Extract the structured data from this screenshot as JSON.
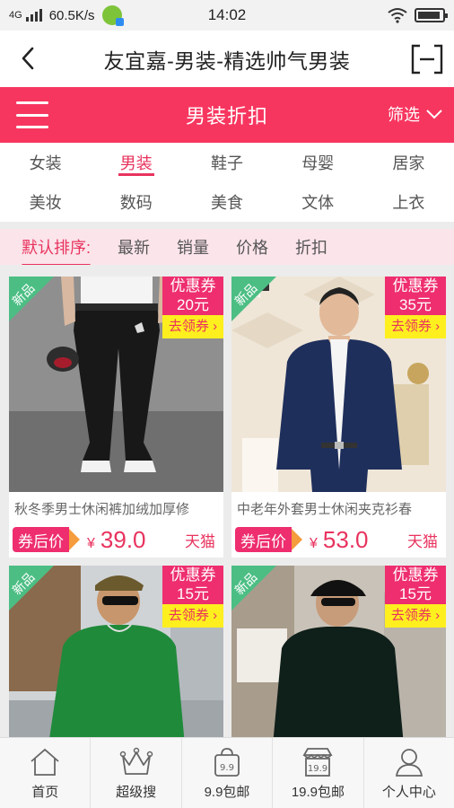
{
  "status_bar": {
    "network": "4G",
    "speed": "60.5K/s",
    "time": "14:02"
  },
  "title_bar": {
    "title": "友宜嘉-男装-精选帅气男装"
  },
  "header": {
    "title": "男装折扣",
    "filter_label": "筛选"
  },
  "categories": [
    "女装",
    "男装",
    "鞋子",
    "母婴",
    "居家",
    "美妆",
    "数码",
    "美食",
    "文体",
    "上衣"
  ],
  "active_category": "男装",
  "sort": {
    "items": [
      "默认排序:",
      "最新",
      "销量",
      "价格",
      "折扣"
    ],
    "active": "默认排序:"
  },
  "products": [
    {
      "name": "秋冬季男士休闲裤加绒加厚修",
      "badge": "新品",
      "coupon_label": "优惠券",
      "coupon_amount": "20元",
      "coupon_action": "去领券",
      "price_tag": "券后价",
      "currency": "¥",
      "price": "39.0",
      "shop": "天猫",
      "image": "black-pants-model"
    },
    {
      "name": "中老年外套男士休闲夹克衫春",
      "badge": "新品",
      "coupon_label": "优惠券",
      "coupon_amount": "35元",
      "coupon_action": "去领券",
      "price_tag": "券后价",
      "currency": "¥",
      "price": "53.0",
      "shop": "天猫",
      "image": "navy-jacket-model",
      "image_text": "卡卢"
    },
    {
      "name": "",
      "badge": "新品",
      "coupon_label": "优惠券",
      "coupon_amount": "15元",
      "coupon_action": "去领券",
      "image": "green-sweater-model"
    },
    {
      "name": "",
      "badge": "新品",
      "coupon_label": "优惠券",
      "coupon_amount": "15元",
      "coupon_action": "去领券",
      "image": "dark-sweater-model"
    }
  ],
  "bottom_nav": [
    {
      "label": "首页",
      "icon": "home-icon"
    },
    {
      "label": "超级搜",
      "icon": "crown-icon"
    },
    {
      "label": "9.9包邮",
      "icon": "bag-icon",
      "icon_text": "9.9"
    },
    {
      "label": "19.9包邮",
      "icon": "shop-icon",
      "icon_text": "19.9"
    },
    {
      "label": "个人中心",
      "icon": "user-icon"
    }
  ],
  "colors": {
    "brand_pink": "#f7365f",
    "accent_pink": "#e8335e",
    "coupon_yellow": "#ffef1f",
    "new_green": "#4cbe84"
  }
}
